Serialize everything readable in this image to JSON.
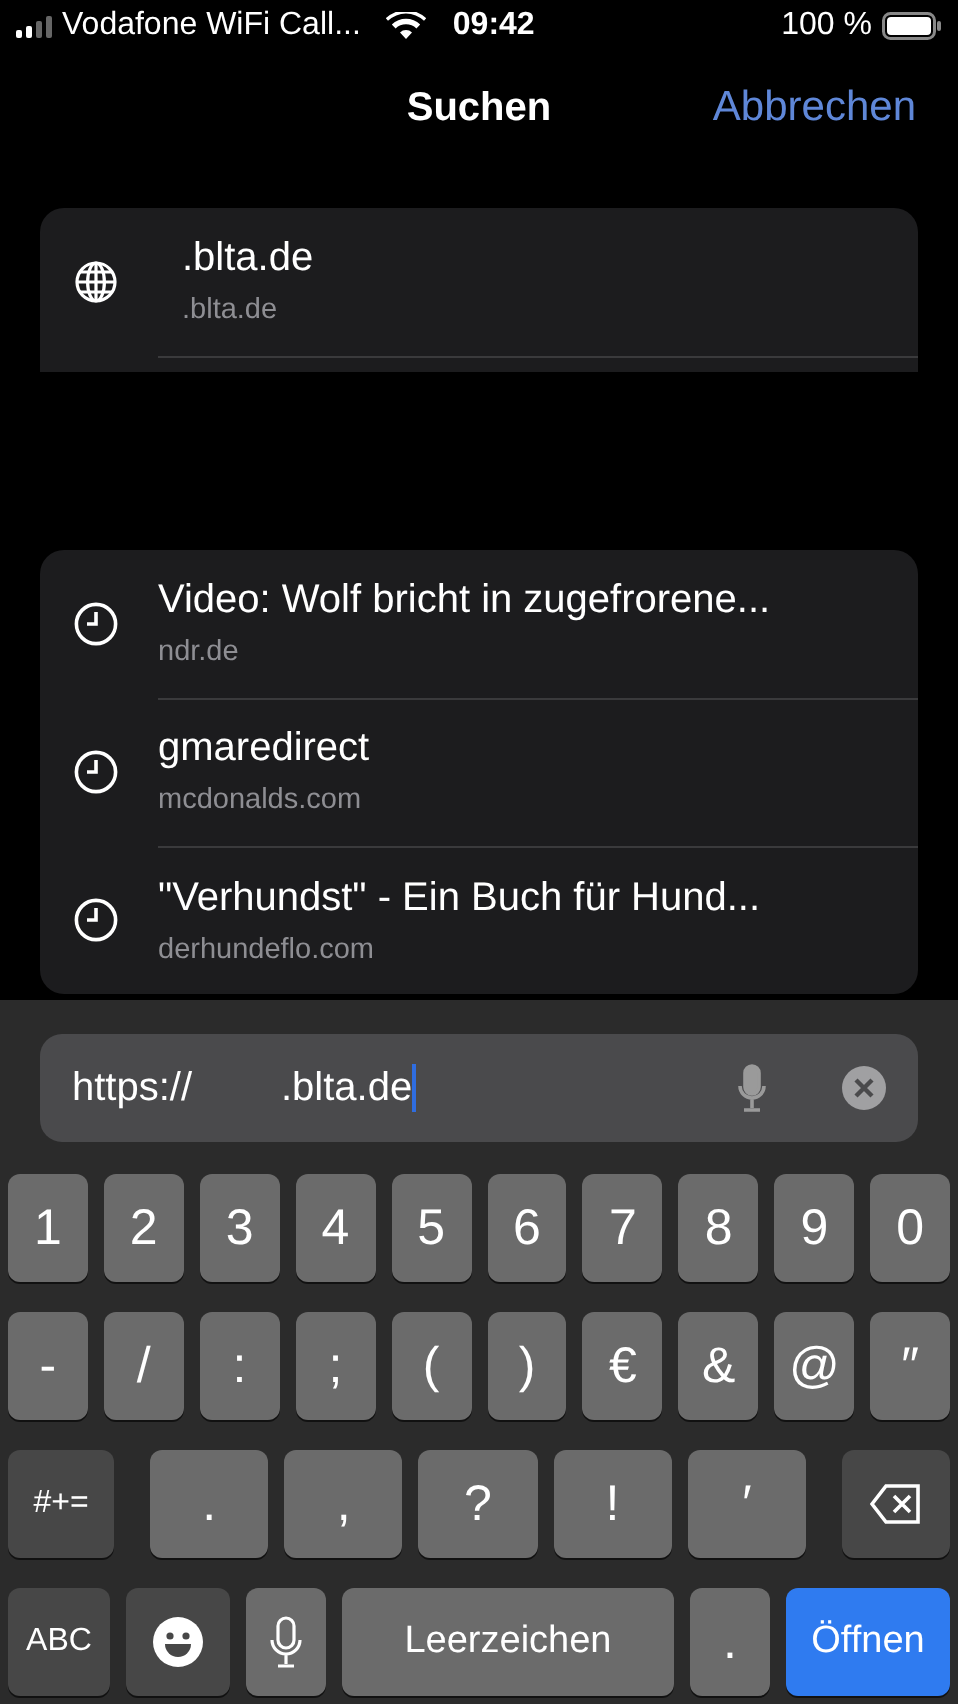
{
  "status_bar": {
    "carrier": "Vodafone WiFi Call...",
    "time": "09:42",
    "battery": "100 %"
  },
  "nav": {
    "title": "Suchen",
    "cancel": "Abbrechen"
  },
  "top_hit": {
    "title": ".blta.de",
    "subtitle": ".blta.de"
  },
  "history": [
    {
      "title": "Video: Wolf bricht in zugefrorene...",
      "subtitle": "ndr.de"
    },
    {
      "title": "gmaredirect",
      "subtitle": "mcdonalds.com"
    },
    {
      "title": "\"Verhundst\" - Ein Buch für Hund...",
      "subtitle": "derhundeflo.com"
    }
  ],
  "url_field": {
    "value": "https://        .blta.de"
  },
  "keyboard": [
    [
      {
        "kind": "char",
        "label": "1"
      },
      {
        "kind": "char",
        "label": "2"
      },
      {
        "kind": "char",
        "label": "3"
      },
      {
        "kind": "char",
        "label": "4"
      },
      {
        "kind": "char",
        "label": "5"
      },
      {
        "kind": "char",
        "label": "6"
      },
      {
        "kind": "char",
        "label": "7"
      },
      {
        "kind": "char",
        "label": "8"
      },
      {
        "kind": "char",
        "label": "9"
      },
      {
        "kind": "char",
        "label": "0"
      }
    ],
    [
      {
        "kind": "char",
        "label": "-"
      },
      {
        "kind": "char",
        "label": "/"
      },
      {
        "kind": "char",
        "label": ":"
      },
      {
        "kind": "char",
        "label": ";"
      },
      {
        "kind": "char",
        "label": "("
      },
      {
        "kind": "char",
        "label": ")"
      },
      {
        "kind": "char",
        "label": "€"
      },
      {
        "kind": "char",
        "label": "&"
      },
      {
        "kind": "char",
        "label": "@"
      },
      {
        "kind": "char",
        "label": "″"
      }
    ],
    [
      {
        "kind": "mode",
        "label": "#+="
      },
      {
        "kind": "wide",
        "label": "."
      },
      {
        "kind": "wide",
        "label": ","
      },
      {
        "kind": "wide",
        "label": "?"
      },
      {
        "kind": "wide",
        "label": "!"
      },
      {
        "kind": "wide",
        "label": "′"
      },
      {
        "kind": "backspace"
      }
    ],
    [
      {
        "kind": "mode",
        "label": "ABC"
      },
      {
        "kind": "emoji"
      },
      {
        "kind": "mic"
      },
      {
        "kind": "space",
        "label": "Leerzeichen"
      },
      {
        "kind": "char",
        "label": "."
      },
      {
        "kind": "open",
        "label": "Öffnen"
      }
    ]
  ]
}
